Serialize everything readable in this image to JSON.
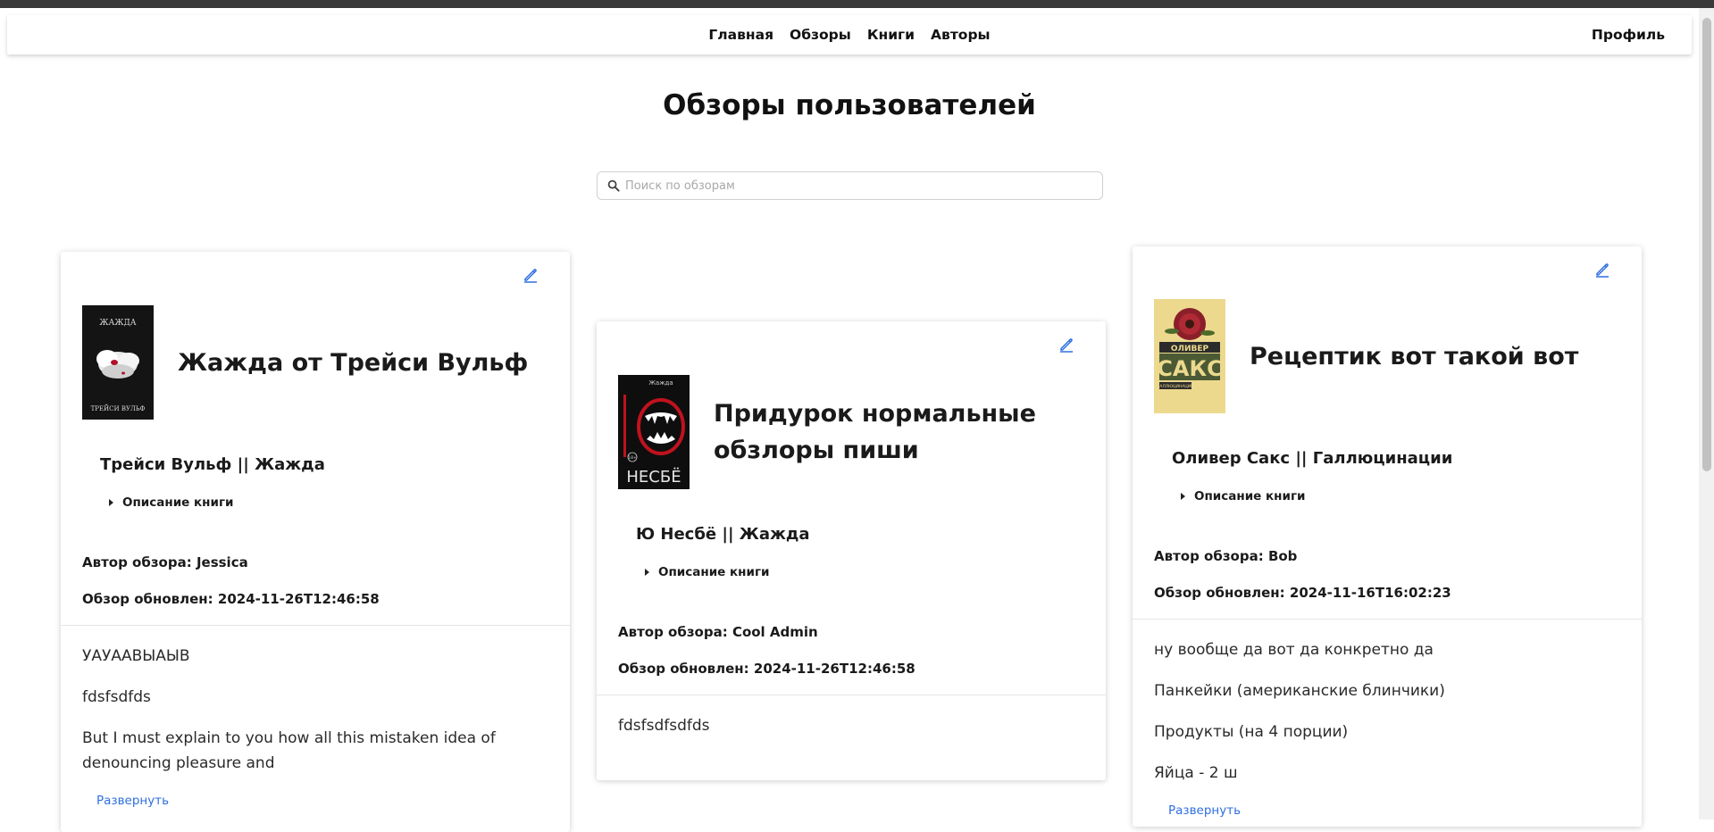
{
  "nav": {
    "links": [
      "Главная",
      "Обзоры",
      "Книги",
      "Авторы"
    ],
    "profile": "Профиль"
  },
  "page": {
    "title": "Обзоры пользователей"
  },
  "search": {
    "placeholder": "Поиск по обзорам",
    "value": ""
  },
  "colors": {
    "accent": "#2f6fe0",
    "text": "#1a1a1a"
  },
  "cards": [
    {
      "title": "Жажда от Трейси Вульф",
      "book": "Трейси Вульф || Жажда",
      "description_toggle": "Описание книги",
      "author": "Автор обзора: Jessica",
      "updated": "Обзор обновлен: 2024-11-26T12:46:58",
      "body": [
        "УАУААВЫАЫВ",
        "fdsfsdfds",
        "But I must explain to you how all this mistaken idea of denouncing pleasure and"
      ],
      "expand": "Развернуть",
      "cover": {
        "top_text": "ЖАЖДА",
        "bottom_text": "ТРЕЙСИ ВУЛЬФ"
      }
    },
    {
      "title": "Придурок нормальные обзлоры пиши",
      "book": "Ю Несбё || Жажда",
      "description_toggle": "Описание книги",
      "author": "Автор обзора: Cool Admin",
      "updated": "Обзор обновлен: 2024-11-26T12:46:58",
      "body": [
        "fdsfsdfsdfds"
      ],
      "cover": {
        "top_text": "Жажда",
        "bottom_text": "НЕСБЁ",
        "badge": "18+"
      }
    },
    {
      "title": "Рецептик вот такой вот",
      "book": "Оливер Сакс || Галлюцинации",
      "description_toggle": "Описание книги",
      "author": "Автор обзора: Bob",
      "updated": "Обзор обновлен: 2024-11-16T16:02:23",
      "body": [
        "ну вообще да вот да конкретно да",
        "Панкейки (американские блинчики)",
        "Продукты (на 4 порции)",
        "Яйца - 2 ш"
      ],
      "expand": "Развернуть",
      "cover": {
        "top_text": "ОЛИВЕР",
        "bottom_text": "САКС",
        "sub_text": "ГАЛЛЮЦИНАЦИИ"
      }
    }
  ]
}
